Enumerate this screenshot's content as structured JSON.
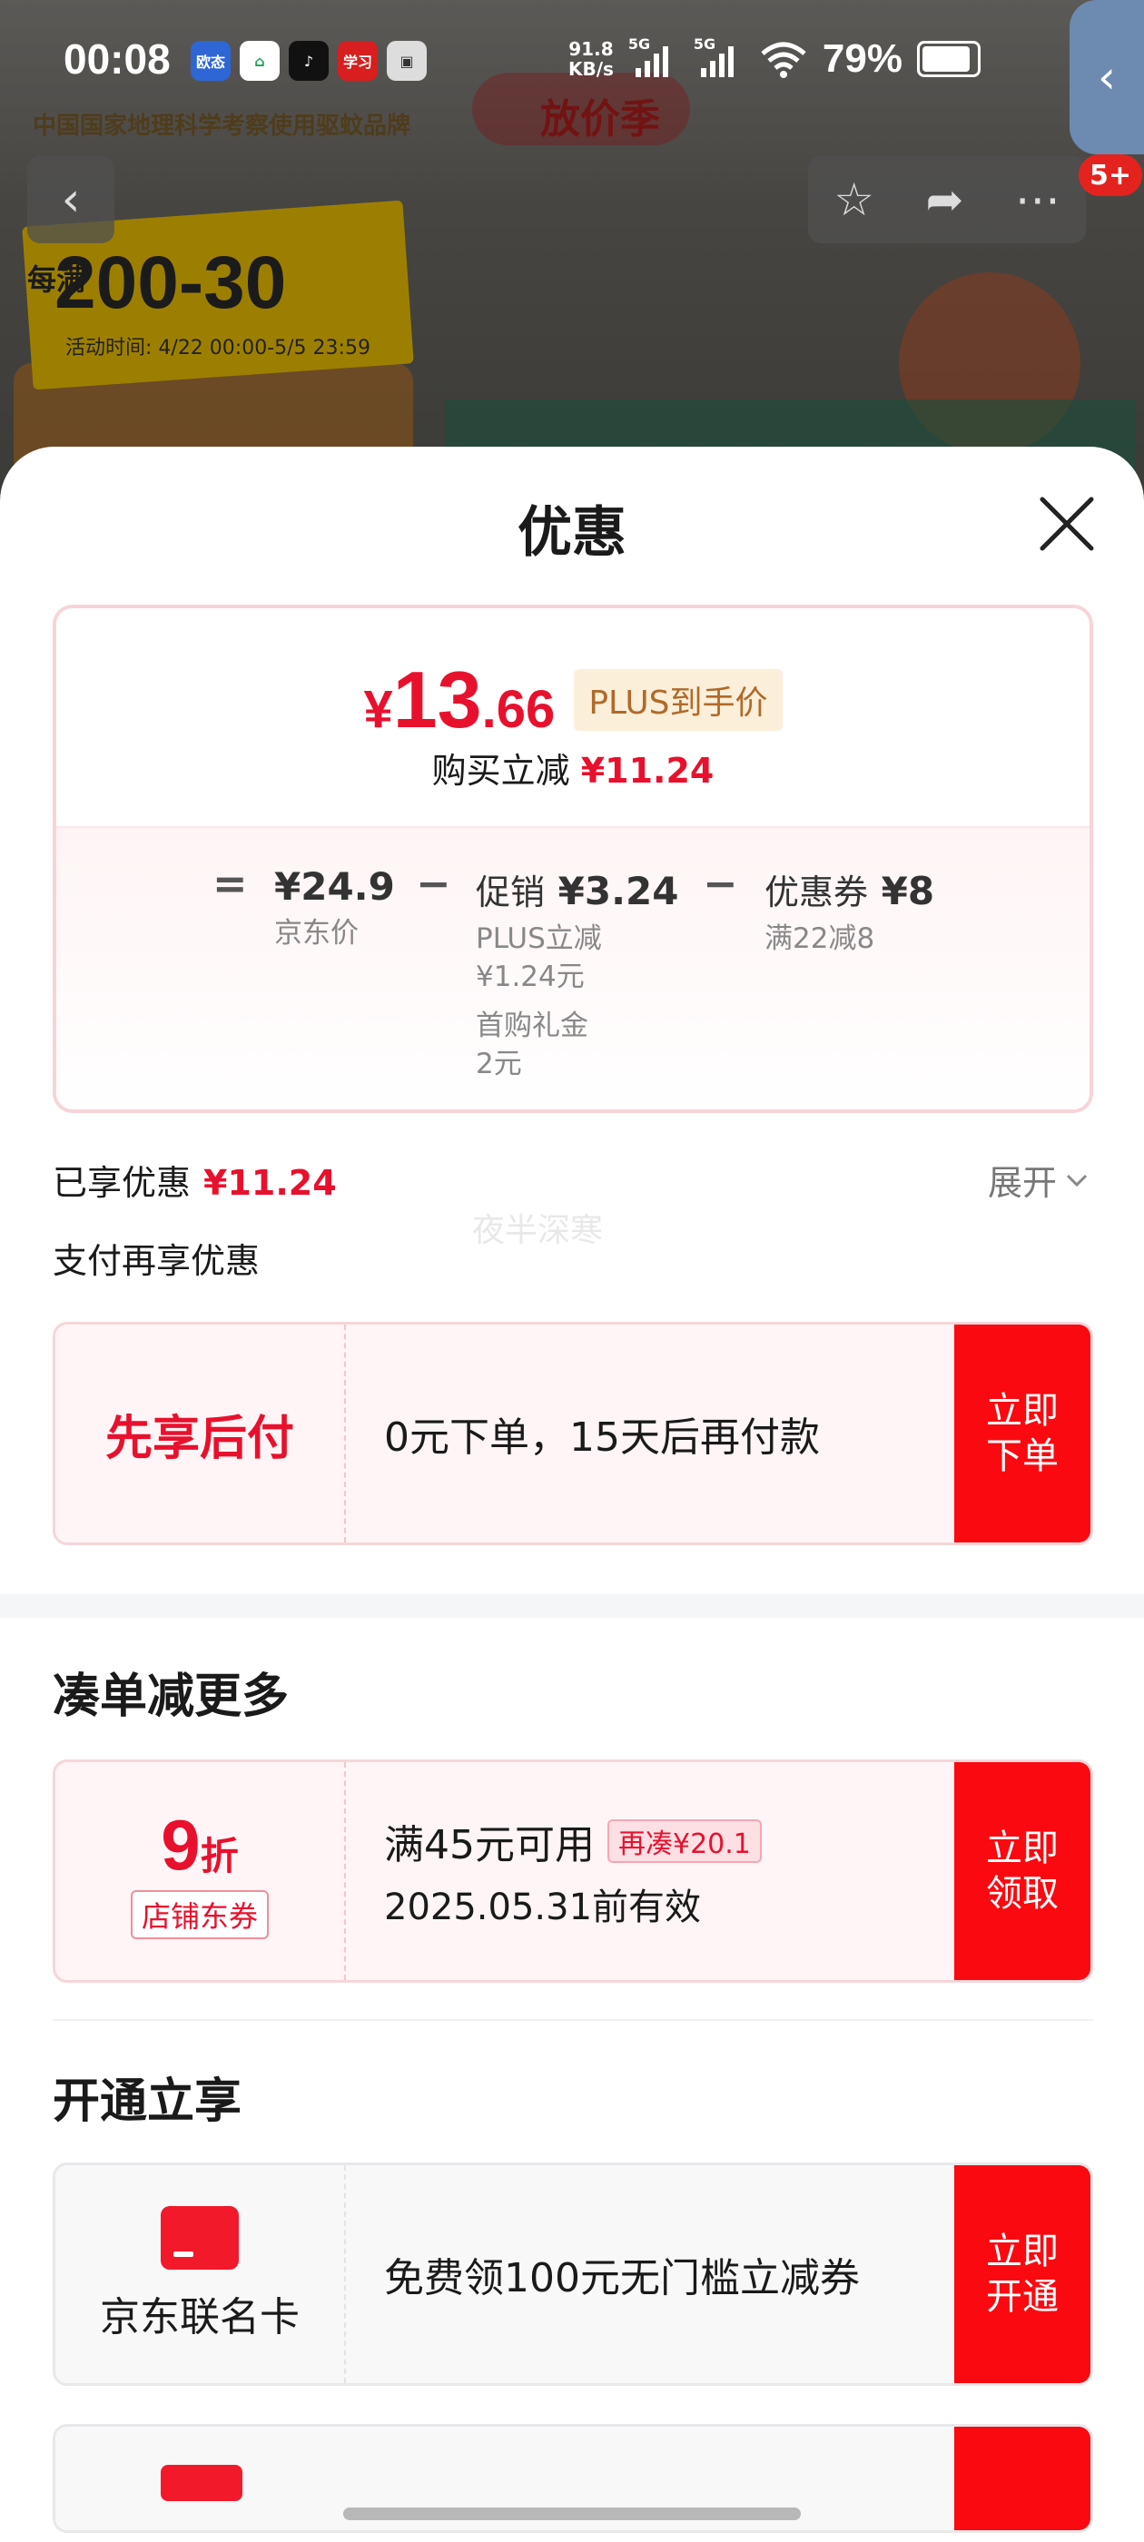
{
  "status_bar": {
    "time": "00:08",
    "apps": [
      "欧态",
      "⌂",
      "♪",
      "学习",
      "▣"
    ],
    "net_speed": "91.8",
    "net_unit": "KB/s",
    "sig1": "5G",
    "sig2": "5G",
    "battery": "79%"
  },
  "background": {
    "brand_text": "中国国家地理科学考察使用驱蚊品牌",
    "season_text": "放价季",
    "banner_prefix": "每满",
    "banner_main": "200-30",
    "banner_sub": "活动时间: 4/22 00:00-5/5 23:59"
  },
  "toolbar": {
    "back_icon": "‹",
    "star_icon": "☆",
    "share_icon": "➦",
    "more_icon": "⋯",
    "badge": "5+"
  },
  "sheet": {
    "title": "优惠",
    "price": {
      "yen": "¥",
      "int": "13",
      "dec": ".66",
      "tag": "PLUS到手价",
      "sub_label": "购买立减",
      "sub_value": "¥11.24"
    },
    "formula": {
      "eq": "=",
      "minus1": "−",
      "minus2": "−",
      "jd_price": "¥24.9",
      "jd_caption": "京东价",
      "promo_label": "促销",
      "promo_value": "¥3.24",
      "promo_cap1": "PLUS立减",
      "promo_cap2": "¥1.24元",
      "promo_cap3": "首购礼金",
      "promo_cap4": "2元",
      "coupon_label": "优惠券",
      "coupon_value": "¥8",
      "coupon_caption": "满22减8"
    },
    "enjoyed_label": "已享优惠",
    "enjoyed_value": "¥11.24",
    "expand_label": "展开",
    "pay_more_label": "支付再享优惠",
    "watermark": "夜半深寒",
    "bnpl": {
      "label": "先享后付",
      "text": "0元下单，15天后再付款",
      "button_l1": "立即",
      "button_l2": "下单"
    },
    "section_bundle": "凑单减更多",
    "coupon": {
      "num": "9",
      "unit": "折",
      "tag": "店铺东券",
      "line1": "满45元可用",
      "extra": "再凑¥20.1",
      "line2": "2025.05.31前有效",
      "button_l1": "立即",
      "button_l2": "领取"
    },
    "section_open": "开通立享",
    "card_offer": {
      "name": "京东联名卡",
      "text": "免费领100元无门槛立减券",
      "button_l1": "立即",
      "button_l2": "开通"
    }
  }
}
